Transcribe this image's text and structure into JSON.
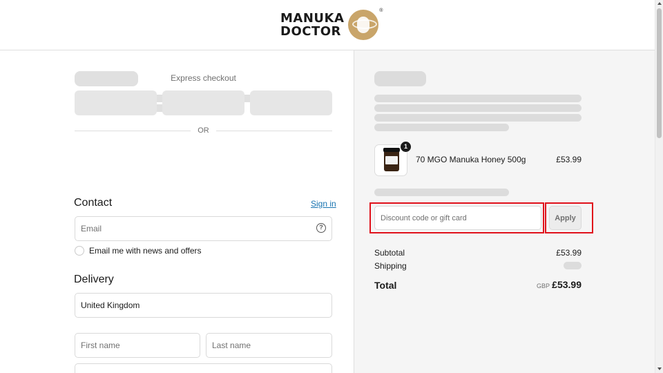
{
  "brand": {
    "line1": "MANUKA",
    "line2": "DOCTOR",
    "reg": "®"
  },
  "express": {
    "label": "Express checkout",
    "divider": "OR"
  },
  "contact": {
    "title": "Contact",
    "sign_in": "Sign in",
    "email_placeholder": "Email",
    "newsletter_label": "Email me with news and offers"
  },
  "delivery": {
    "title": "Delivery",
    "country": "United Kingdom",
    "first_name_placeholder": "First name",
    "last_name_placeholder": "Last name"
  },
  "order": {
    "item": {
      "name": "70 MGO Manuka Honey 500g",
      "price": "£53.99",
      "quantity": "1"
    },
    "discount_placeholder": "Discount code or gift card",
    "apply_label": "Apply",
    "subtotal_label": "Subtotal",
    "subtotal_value": "£53.99",
    "shipping_label": "Shipping",
    "total_label": "Total",
    "currency": "GBP",
    "total_value": "£53.99"
  },
  "colors": {
    "link": "#1773b0",
    "highlight": "#e0101a",
    "brand_gold": "#c9a56a"
  }
}
